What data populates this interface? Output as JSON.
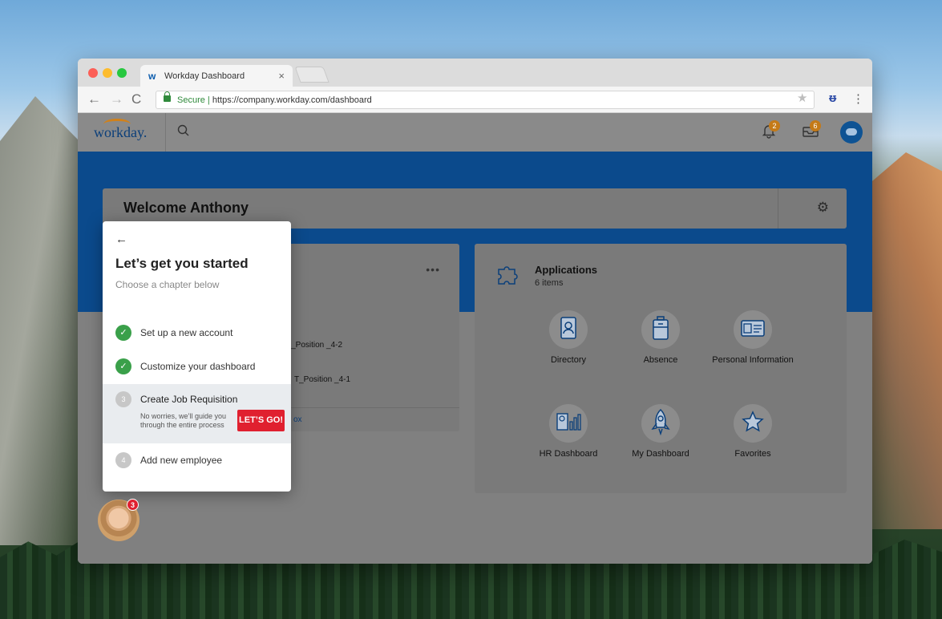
{
  "browser": {
    "tab_title": "Workday Dashboard",
    "tab_logo": "w",
    "tab_close": "×",
    "url_secure": "Secure",
    "url_sep": " | ",
    "url": "https://company.workday.com/dashboard"
  },
  "header": {
    "logo_text": "workday.",
    "notifications_count": "2",
    "inbox_count": "6"
  },
  "welcome": {
    "title": "Welcome Anthony"
  },
  "worklet": {
    "items": [
      "T_Position _4-2",
      "T_Position _4-1"
    ],
    "footer_link": "ox"
  },
  "applications": {
    "title": "Applications",
    "count": "6 items",
    "apps": [
      {
        "label": "Directory",
        "icon": "directory-icon"
      },
      {
        "label": "Absence",
        "icon": "absence-icon"
      },
      {
        "label": "Personal Information",
        "icon": "personal-information-icon"
      },
      {
        "label": "HR Dashboard",
        "icon": "hr-dashboard-icon"
      },
      {
        "label": "My Dashboard",
        "icon": "my-dashboard-icon"
      },
      {
        "label": "Favorites",
        "icon": "favorites-icon"
      }
    ]
  },
  "onboarding": {
    "title": "Let’s get you started",
    "subtitle": "Choose a chapter below",
    "steps": [
      {
        "label": "Set up a new account",
        "status": "done"
      },
      {
        "label": "Customize your dashboard",
        "status": "done"
      },
      {
        "label": "Create Job Requisition",
        "status": "active",
        "number": "3",
        "desc": "No worries, we’ll guide you through the entire process",
        "cta": "LET’S GO!"
      },
      {
        "label": "Add new employee",
        "status": "todo",
        "number": "4"
      }
    ]
  },
  "assistant": {
    "badge": "3"
  },
  "colors": {
    "workday_blue": "#0b4a8c",
    "accent_orange": "#d1811a",
    "cta_red": "#e0202f",
    "done_green": "#3aa04a"
  }
}
